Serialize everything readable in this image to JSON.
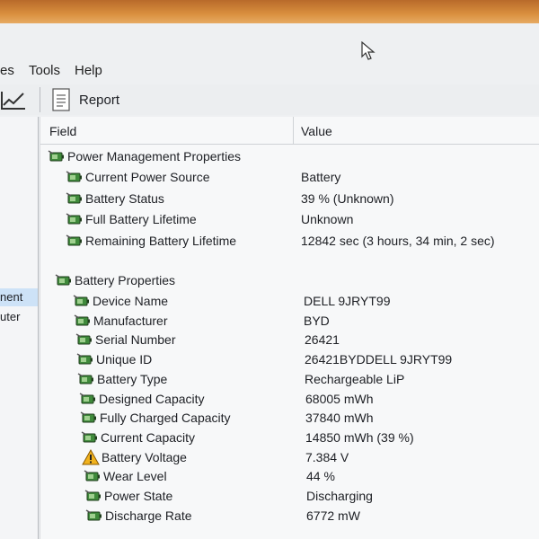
{
  "menu": [
    "es",
    "Tools",
    "Help"
  ],
  "toolbar": {
    "report_label": "Report"
  },
  "left_pane": [
    "nent",
    "uter"
  ],
  "columns": {
    "field": "Field",
    "value": "Value"
  },
  "power_section": {
    "title": "Power Management Properties",
    "rows": [
      {
        "field": "Current Power Source",
        "value": "Battery"
      },
      {
        "field": "Battery Status",
        "value": "39 % (Unknown)"
      },
      {
        "field": "Full Battery Lifetime",
        "value": "Unknown"
      },
      {
        "field": "Remaining Battery Lifetime",
        "value": "12842 sec (3 hours, 34 min, 2 sec)"
      }
    ]
  },
  "battery_section": {
    "title": "Battery Properties",
    "rows": [
      {
        "field": "Device Name",
        "value": "DELL 9JRYT99",
        "icon": "battery-icon"
      },
      {
        "field": "Manufacturer",
        "value": "BYD",
        "icon": "battery-icon"
      },
      {
        "field": "Serial Number",
        "value": "26421",
        "icon": "battery-icon"
      },
      {
        "field": "Unique ID",
        "value": "26421BYDDELL 9JRYT99",
        "icon": "battery-icon"
      },
      {
        "field": "Battery Type",
        "value": "Rechargeable LiP",
        "icon": "battery-icon"
      },
      {
        "field": "Designed Capacity",
        "value": "68005 mWh",
        "icon": "battery-icon"
      },
      {
        "field": "Fully Charged Capacity",
        "value": "37840 mWh",
        "icon": "battery-icon"
      },
      {
        "field": "Current Capacity",
        "value": "14850 mWh  (39 %)",
        "icon": "battery-icon"
      },
      {
        "field": "Battery Voltage",
        "value": "7.384 V",
        "icon": "warning-icon"
      },
      {
        "field": "Wear Level",
        "value": "44 %",
        "icon": "battery-icon"
      },
      {
        "field": "Power State",
        "value": "Discharging",
        "icon": "battery-icon"
      },
      {
        "field": "Discharge Rate",
        "value": "6772 mW",
        "icon": "battery-icon"
      }
    ]
  },
  "colors": {
    "warning": "#f1b21d",
    "battery_green": "#3f8a3b",
    "selection": "#cde2f7"
  }
}
